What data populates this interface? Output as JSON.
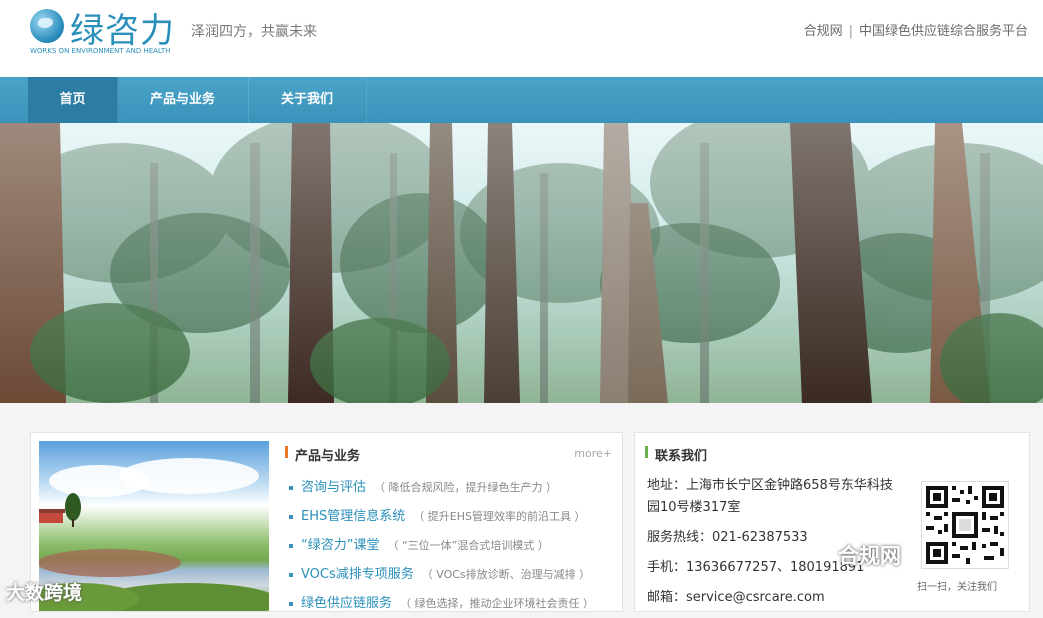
{
  "header": {
    "logo_text": "绿咨力",
    "logo_subtitle": "WORKS ON ENVIRONMENT AND HEALTH",
    "slogan": "泽润四方，共赢未来",
    "top_link_1": "合规网",
    "top_separator": "|",
    "top_link_2": "中国绿色供应链综合服务平台"
  },
  "nav": {
    "items": [
      {
        "label": "首页"
      },
      {
        "label": "产品与业务"
      },
      {
        "label": "关于我们"
      }
    ]
  },
  "products": {
    "title": "产品与业务",
    "more": "more+",
    "items": [
      {
        "name": "咨询与评估",
        "desc": "（ 降低合规风险，提升绿色生产力 ）"
      },
      {
        "name": "EHS管理信息系统",
        "desc": "（ 提升EHS管理效率的前沿工具 ）"
      },
      {
        "name": "“绿咨力”课堂",
        "desc": "（ “三位一体”混合式培训模式 ）"
      },
      {
        "name": "VOCs减排专项服务",
        "desc": "（ VOCs排放诊断、治理与减排 ）"
      },
      {
        "name": "绿色供应链服务",
        "desc": "（ 绿色选择，推动企业环境社会责任 ）"
      }
    ]
  },
  "contact": {
    "title": "联系我们",
    "address": "地址：上海市长宁区金钟路658号东华科技园10号楼317室",
    "hotline": "服务热线：021-62387533",
    "mobile": "手机：13636677257、180191891",
    "email": "邮箱：service@csrcare.com",
    "qr_caption": "扫一扫，关注我们"
  },
  "watermark": {
    "left": "大数跨境",
    "right": "合规网"
  },
  "colors": {
    "brand_blue": "#2a8fba",
    "nav_blue": "#3a93ba",
    "nav_active": "#2c7ca3",
    "accent_orange": "#e8792b",
    "accent_green": "#6ab04c"
  }
}
